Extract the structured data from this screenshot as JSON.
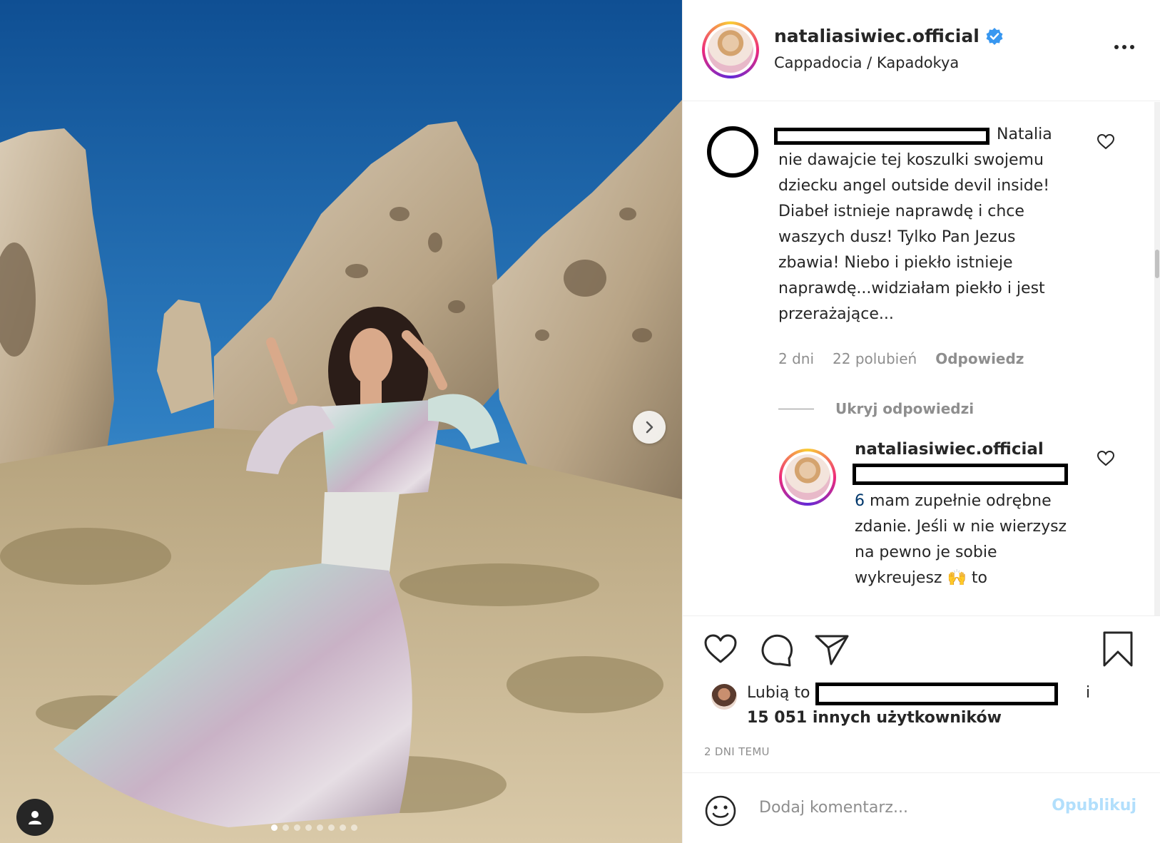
{
  "post": {
    "username": "nataliasiwiec.official",
    "location": "Cappadocia / Kapadokya",
    "verified_icon": "verified-badge-icon",
    "photo_alt": "",
    "carousel": {
      "total": 8,
      "active": 1
    }
  },
  "comment": {
    "text_first": "Natalia",
    "text_rest": "nie dawajcie tej koszulki swojemu dziecku angel outside devil inside! Diabeł istnieje naprawdę i chce waszych dusz! Tylko Pan Jezus zbawia! Niebo i piekło istnieje naprawdę...widziałam piekło i jest przerażające...",
    "time": "2 dni",
    "likes": "22 polubień",
    "reply_label": "Odpowiedz",
    "hide_replies_label": "Ukryj odpowiedzi"
  },
  "reply": {
    "username": "nataliasiwiec.official",
    "number": "6",
    "text": " mam zupełnie odrębne zdanie. Jeśli w nie wierzysz na pewno je sobie wykreujesz",
    "emoji": "🙌",
    "tail": " to"
  },
  "likes": {
    "prefix": "Lubią to",
    "suffix": "i",
    "others": "15 051 innych użytkowników"
  },
  "post_time": "2 DNI TEMU",
  "add_comment": {
    "placeholder": "Dodaj komentarz...",
    "publish_label": "Opublikuj"
  },
  "colors": {
    "accent": "#0095f6",
    "publish_disabled": "#b2dffc",
    "muted": "#8e8e8e",
    "text": "#262626"
  }
}
